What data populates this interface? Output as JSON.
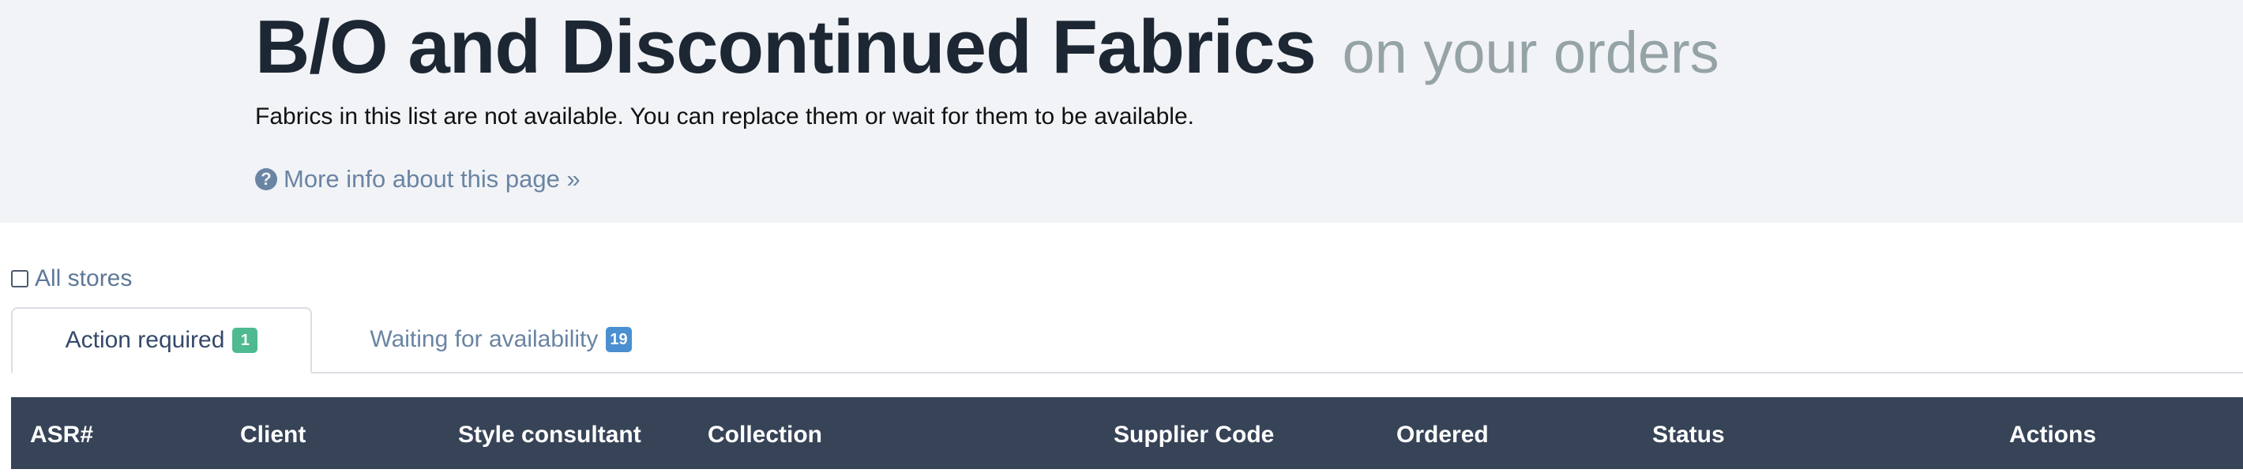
{
  "header": {
    "title": "B/O and Discontinued Fabrics",
    "title_suffix": "on your orders",
    "description": "Fabrics in this list are not available. You can replace them or wait for them to be available.",
    "more_info_label": "More info about this page »",
    "more_info_icon": "question-circle-icon"
  },
  "filters": {
    "all_stores_label": "All stores",
    "all_stores_checked": false
  },
  "tabs": [
    {
      "label": "Action required",
      "count": "1",
      "active": true,
      "badge_color": "#4fba8f"
    },
    {
      "label": "Waiting for availability",
      "count": "19",
      "active": false,
      "badge_color": "#4a8fd0"
    }
  ],
  "table": {
    "columns": [
      "ASR#",
      "Client",
      "Style consultant",
      "Collection",
      "Supplier Code",
      "Ordered",
      "Status",
      "Actions"
    ],
    "header_color": "#374357"
  },
  "colors": {
    "hero_background": "#f1f3f7",
    "link": "#6a84a3",
    "title": "#1d2733",
    "title_muted": "#95a3a6"
  }
}
